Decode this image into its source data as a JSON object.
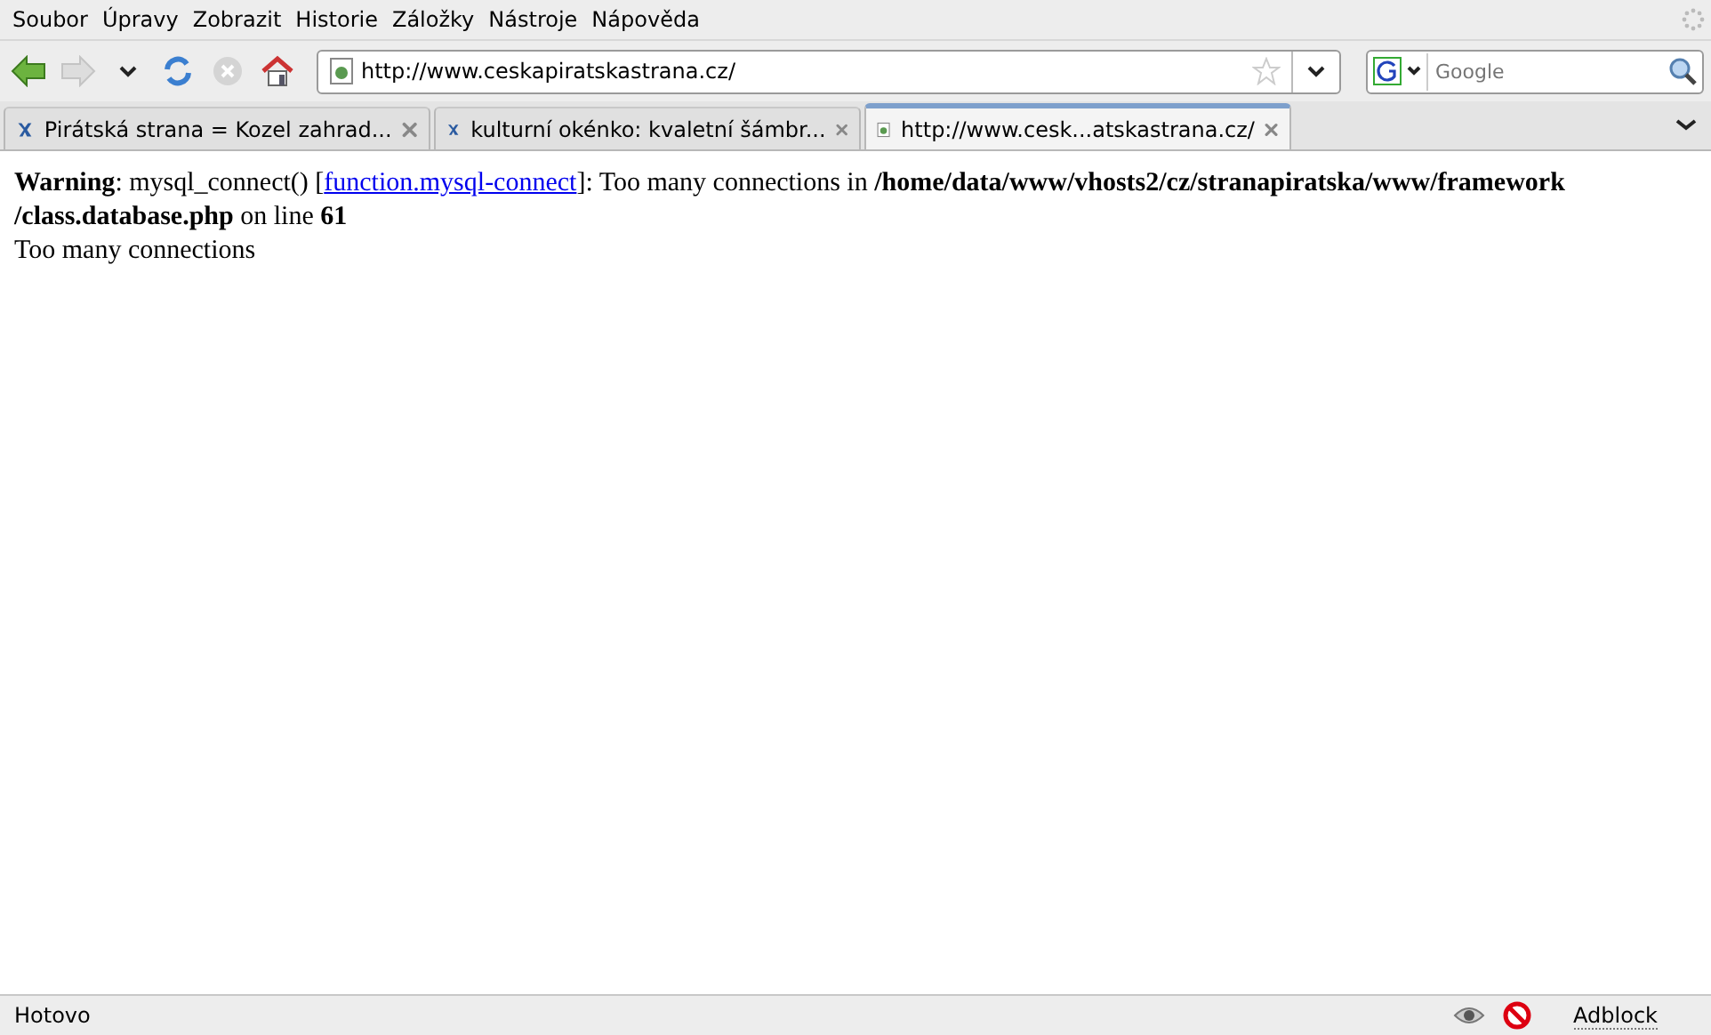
{
  "menu": [
    "Soubor",
    "Úpravy",
    "Zobrazit",
    "Historie",
    "Záložky",
    "Nástroje",
    "Nápověda"
  ],
  "address": {
    "value": "http://www.ceskapiratskastrana.cz/"
  },
  "search": {
    "placeholder": "Google"
  },
  "tabs": [
    {
      "label": "Pirátská strana = Kozel zahrad...",
      "selected": false,
      "kind": "site"
    },
    {
      "label": "kulturní okénko: kvaletní šámbr...",
      "selected": false,
      "kind": "site"
    },
    {
      "label": "http://www.cesk...atskastrana.cz/",
      "selected": true,
      "kind": "page"
    }
  ],
  "content": {
    "warning_before": "**Warning**: mysql_connect() [",
    "warning_link": "function.mysql-connect",
    "warning_after": "]: Too many connections in **/home/data/www/vhosts2/cz/stranapiratska/www/framework /class.database.php** on line **61**",
    "message": "Too many connections"
  },
  "status_bar": {
    "text": "Hotovo",
    "addon": "Adblock"
  }
}
